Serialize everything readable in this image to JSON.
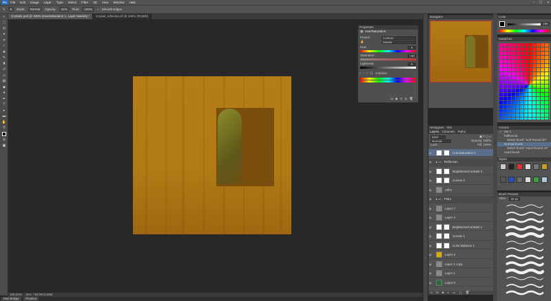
{
  "app": {
    "logo": "Ps"
  },
  "menu": [
    "File",
    "Edit",
    "Image",
    "Layer",
    "Type",
    "Select",
    "Filter",
    "3D",
    "View",
    "Window",
    "Help"
  ],
  "window_controls": [
    "–",
    "☐",
    "✕"
  ],
  "options": {
    "mode_label": "Mode:",
    "mode": "Normal",
    "opacity_label": "Opacity:",
    "opacity": "21%",
    "flow_label": "Flow:",
    "flow": "100%",
    "smooth_label": "Smooth Edges"
  },
  "doc_tabs": [
    "Crystal1.psd @ 100% (Hue/Saturation 1, Layer Mask/8) *",
    "Crystal_reflection.tif @ 100% (RGB/8)"
  ],
  "status": {
    "zoom": "100.00%",
    "doc": "Doc: 768.0K/4.00M"
  },
  "bottom_tabs": [
    "Mini Bridge",
    "Timeline"
  ],
  "properties": {
    "tab": "Properties",
    "title": "Hue/Saturation",
    "preset_label": "Preset:",
    "preset": "Custom",
    "channel": "Master",
    "hue_label": "Hue:",
    "hue": "0",
    "sat_label": "Saturation:",
    "sat": "+30",
    "light_label": "Lightness:",
    "light": "0",
    "colorize": "Colorize"
  },
  "navigator": {
    "tab": "Navigator"
  },
  "histogram_tabs": [
    "Histogram",
    "Info"
  ],
  "layers_tabs": [
    "Layers",
    "Channels",
    "Paths"
  ],
  "layers_controls": {
    "kind": "Kind",
    "blend": "Normal",
    "opacity": "Opacity: 100%",
    "lock": "Lock:",
    "fill": "Fill: 100%"
  },
  "layers": [
    {
      "name": "Hue/Saturation 1",
      "type": "adj",
      "sel": true
    },
    {
      "name": "Reflection",
      "type": "group"
    },
    {
      "name": "Brightness/Contrast 2",
      "type": "adj"
    },
    {
      "name": "Curves 2",
      "type": "adj"
    },
    {
      "name": "reflct",
      "type": "pix"
    },
    {
      "name": "Pluto",
      "type": "group"
    },
    {
      "name": "Layer 7",
      "type": "pix"
    },
    {
      "name": "Layer 4",
      "type": "pix"
    },
    {
      "name": "Brightness/Contrast 1",
      "type": "adj"
    },
    {
      "name": "Curves 1",
      "type": "adj"
    },
    {
      "name": "Color Balance 1",
      "type": "adj"
    },
    {
      "name": "Layer 2",
      "type": "yellow"
    },
    {
      "name": "Layer 1 copy",
      "type": "pix"
    },
    {
      "name": "Layer 1",
      "type": "pix"
    },
    {
      "name": "Layer 0",
      "type": "green"
    }
  ],
  "color": {
    "tab": "Color",
    "value": "255"
  },
  "swatches": {
    "tab": "Swatches"
  },
  "actions": {
    "tab": "Actions",
    "items": [
      "Set 1",
      "halftoscat",
      "Select brush \"soft Round 30\"",
      "Normal brush",
      "Select brush \"Hard Round 10\"",
      "Hard brush"
    ]
  },
  "styles": {
    "tab": "Styles"
  },
  "brush_presets": {
    "tab": "Brush Presets",
    "size_label": "Size:",
    "size": "30 px"
  },
  "colors": {
    "canvas": "#b47d16",
    "inset": "#7a4e0f",
    "panel": "#535353",
    "selected_layer": "#5a6f8c"
  }
}
